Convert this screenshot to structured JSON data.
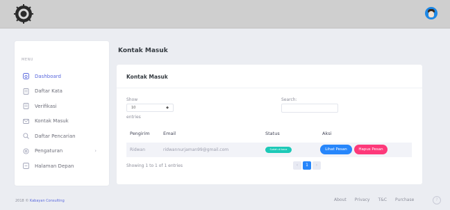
{
  "sidebar": {
    "menu_label": "MENU",
    "items": [
      {
        "label": "Dashboard",
        "icon": "dashboard-icon"
      },
      {
        "label": "Daftar Kata",
        "icon": "document-icon"
      },
      {
        "label": "Verifikasi",
        "icon": "document-icon"
      },
      {
        "label": "Kontak Masuk",
        "icon": "mail-icon"
      },
      {
        "label": "Daftar Pencarian",
        "icon": "search-icon"
      },
      {
        "label": "Pengaturan",
        "icon": "gear-icon"
      },
      {
        "label": "Halaman Depan",
        "icon": "home-icon"
      }
    ],
    "active_color": "#5867dd"
  },
  "main": {
    "page_title": "Kontak Masuk",
    "card_title": "Kontak Masuk",
    "show_label": "Show",
    "show_value": "10",
    "entries_label": "entries",
    "search_label": "Search:",
    "columns": [
      "Pengirim",
      "Email",
      "Status",
      "Aksi"
    ],
    "rows": [
      {
        "pengirim": "Ridwan",
        "email": "ridwannurjaman99@gmail.com",
        "status": "Sudah di baca",
        "view_label": "Lihat Pesan",
        "delete_label": "Hapus Pesan"
      }
    ],
    "info": "Showing 1 to 1 of 1 entries",
    "pagination": {
      "prev": "‹",
      "current": "1",
      "next": "›"
    }
  },
  "footer": {
    "copyright_prefix": "2018 ©",
    "brand": "Kabayan Consulting",
    "links": [
      "About",
      "Privacy",
      "T&C",
      "Purchase"
    ],
    "help": "?"
  },
  "colors": {
    "primary": "#2786fb",
    "danger": "#fd397a",
    "success": "#1dc9b7",
    "topbar": "#cfcfcf"
  }
}
